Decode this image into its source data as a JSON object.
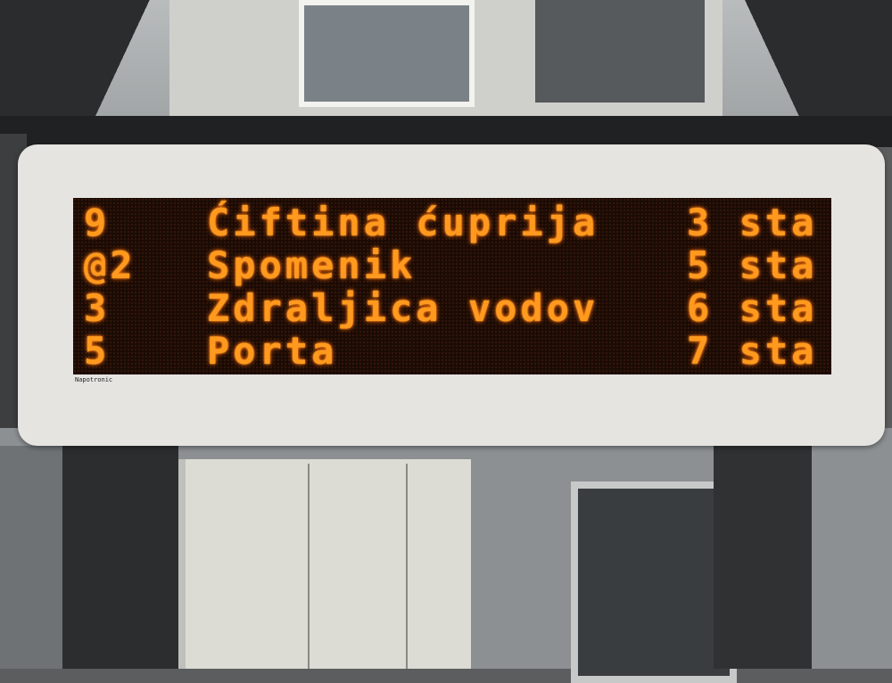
{
  "display": {
    "brand": "Napotronic",
    "led_color": "#ff9a1e",
    "rows": [
      {
        "line": "9",
        "destination": "Ćiftina ćuprija",
        "time": "3 sta"
      },
      {
        "line": "@2",
        "destination": "Spomenik",
        "time": "5 sta"
      },
      {
        "line": "3",
        "destination": "Zdraljica vodov",
        "time": "6 sta"
      },
      {
        "line": "5",
        "destination": "Porta",
        "time": "7 sta"
      }
    ]
  }
}
